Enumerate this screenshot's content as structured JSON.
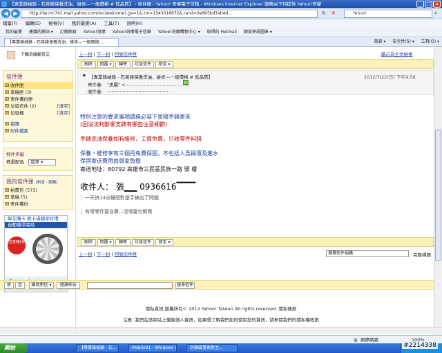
{
  "window": {
    "title": "【專業錶械錶 - 石英錶保養洗油、維修---一級價格 # 低品質】 - 收件匣 - Yahoo! 奇摩電子信箱 - Windows Internet Explorer 服務由下列提供 Yahoo!奇摩",
    "url": "http://tw.mc741.mail.yahoo.com/mc/welcome?.gx=1&.tm=1343016672&.rand=0e6b5bd7ab4d...",
    "search_placeholder": "Yahoo!"
  },
  "menu": [
    "檔案(F)",
    "編輯(E)",
    "檢視(V)",
    "我的最愛(A)",
    "工具(T)",
    "說明(H)"
  ],
  "favorites": [
    "我的最愛",
    "建議的網站 ▾",
    "訂閱網頁",
    "Yahoo!奇摩",
    "Yahoo!奇摩電子信箱",
    "Yahoo!奇摩購物中心 ▾",
    "取得的 Hotmail",
    "網頁快訊圖庫 ▾"
  ],
  "tab": {
    "label": "【專業錶械錶 - 石英錶保養洗油、維修---一級價格 ..."
  },
  "tools": [
    "首頁 ▾",
    "安全性(S) ▾",
    "工具(O) ▾"
  ],
  "sidebar": {
    "user_text": "下載奇摩輸英文",
    "mail_panel": {
      "title": "信件匣",
      "items": [
        {
          "label": "收件匣",
          "right": ""
        },
        {
          "label": "草稿匣 (3)",
          "right": ""
        },
        {
          "label": "寄件備份匣",
          "right": ""
        },
        {
          "label": "垃圾信件 (2)",
          "right": "[清空]"
        },
        {
          "label": "垃圾桶",
          "right": "[清空]"
        }
      ],
      "extra": [
        "相簿",
        "附件檔案"
      ]
    },
    "theme_panel": {
      "title": "郵件美編",
      "label": "佈景配色",
      "select": "翡翠 ▾"
    },
    "folder_panel": {
      "title": "我的信件匣",
      "actions": "[新增 - 編輯]",
      "items": [
        "拍賣信 (573)",
        "草稿 (5)",
        "寄件備份"
      ]
    },
    "ad": {
      "line1": "聯花購卡 刷卡滿額享好禮",
      "line2": "自動循環電扇",
      "badge": "立即刷卡",
      "foot": "環境理解 我用卡"
    }
  },
  "main": {
    "pager": {
      "prev": "上一封",
      "next": "下一封",
      "back": "回到信件匣",
      "show_text": "顯示為全文檢視",
      "pages": "|◀ ◀ ▶ ▶|"
    },
    "buttons": [
      "刪除",
      "回覆 ▾",
      "轉寄",
      "垃圾信件",
      "移至 ▾"
    ],
    "mail": {
      "subject": "【專業錶械錶 - 石英錶保養洗油、維修---一級價格 # 低品質】",
      "date": "2012/7/22(日) 下午9:56",
      "from_label": "寄件者:",
      "from_value": "\"黑屬\" <..........................................>",
      "to_label": "收件者:",
      "to_value": "..........................................."
    },
    "body": {
      "line1": "特別注意的要求事項請務必寫下並隨手錶寄來",
      "line2": "(因沒法判斷哪支錶有哪些注意細節)",
      "line3": "手錶洗油保養如有維修，工資免費，只收零件料錢",
      "line4": "保養丶維修享有三個月免費保固，不包括人爲損壞及進水",
      "line5": "保固寄送費用由買家負擔",
      "line6": "寄送地址：80792 高雄市三民區民族一路        號   樓",
      "recipient": "收件人：  張▁▁  0936616▔▔▔",
      "sig1": "一天快14分鐘絕對是手錶出了問題",
      "sig2": "有壞零件要自費...沒壞要付郵資"
    },
    "bottom_pager": {
      "prev": "上一封",
      "next": "下一封",
      "back": "回到信件匣",
      "select": "選擇信件捐購",
      "go": "完整標題"
    }
  },
  "bottombar": {
    "receive": "收",
    "compose": "信",
    "new_mail": "編寫新信 ▾",
    "read": "閱讀佈告",
    "search_btn": "搜尋信件"
  },
  "footer": {
    "line1": "隱私資訊 版權所有© 2012 Yahoo! Taiwan All rights reserved. 隱私條款",
    "line2": "注意: 我們在該網站上蒐集個人資訊，如果想了解我們如何使用您的資訊，請參閱我們的隱私權政策"
  },
  "status": {
    "zone": "網際網路",
    "zoom": "100%"
  },
  "taskbar": {
    "start": "開始",
    "tasks": [
      "【專業錶械錶 - 石...",
      "Mobile01 - Windows I...",
      "討論區發表新主..."
    ],
    "clock": "下午 10:51"
  },
  "watermark": "#2214338"
}
